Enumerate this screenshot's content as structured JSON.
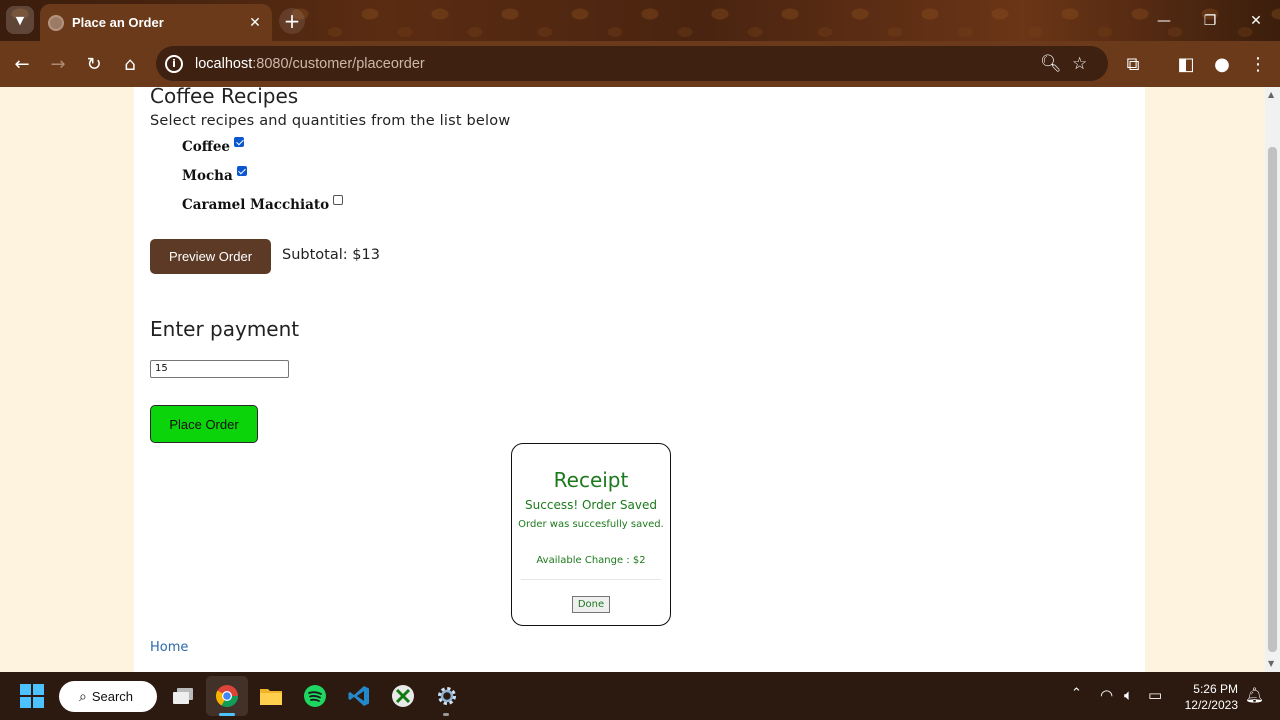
{
  "browser": {
    "tab_title": "Place an Order",
    "url_host": "localhost",
    "url_rest": ":8080/customer/placeorder"
  },
  "page": {
    "recipes_heading": "Coffee Recipes",
    "recipes_subheading": "Select recipes and quantities from the list below",
    "recipes": [
      {
        "name": "Coffee",
        "checked": true
      },
      {
        "name": "Mocha",
        "checked": true
      },
      {
        "name": "Caramel Macchiato",
        "checked": false
      }
    ],
    "preview_button": "Preview Order",
    "subtotal": "Subtotal: $13",
    "payment_heading": "Enter payment",
    "payment_value": "15",
    "place_order_button": "Place Order",
    "receipt": {
      "title": "Receipt",
      "status": "Success! Order Saved",
      "message": "Order was succesfully saved.",
      "change": "Available Change : $2",
      "done_button": "Done"
    },
    "home_link": "Home"
  },
  "taskbar": {
    "search_label": "Search",
    "time": "5:26 PM",
    "date": "12/2/2023"
  },
  "colors": {
    "place_order_bg": "#0bd40b",
    "preview_bg": "#5c3a26",
    "receipt_text": "#1c7a1c",
    "link": "#2a6aa8"
  }
}
